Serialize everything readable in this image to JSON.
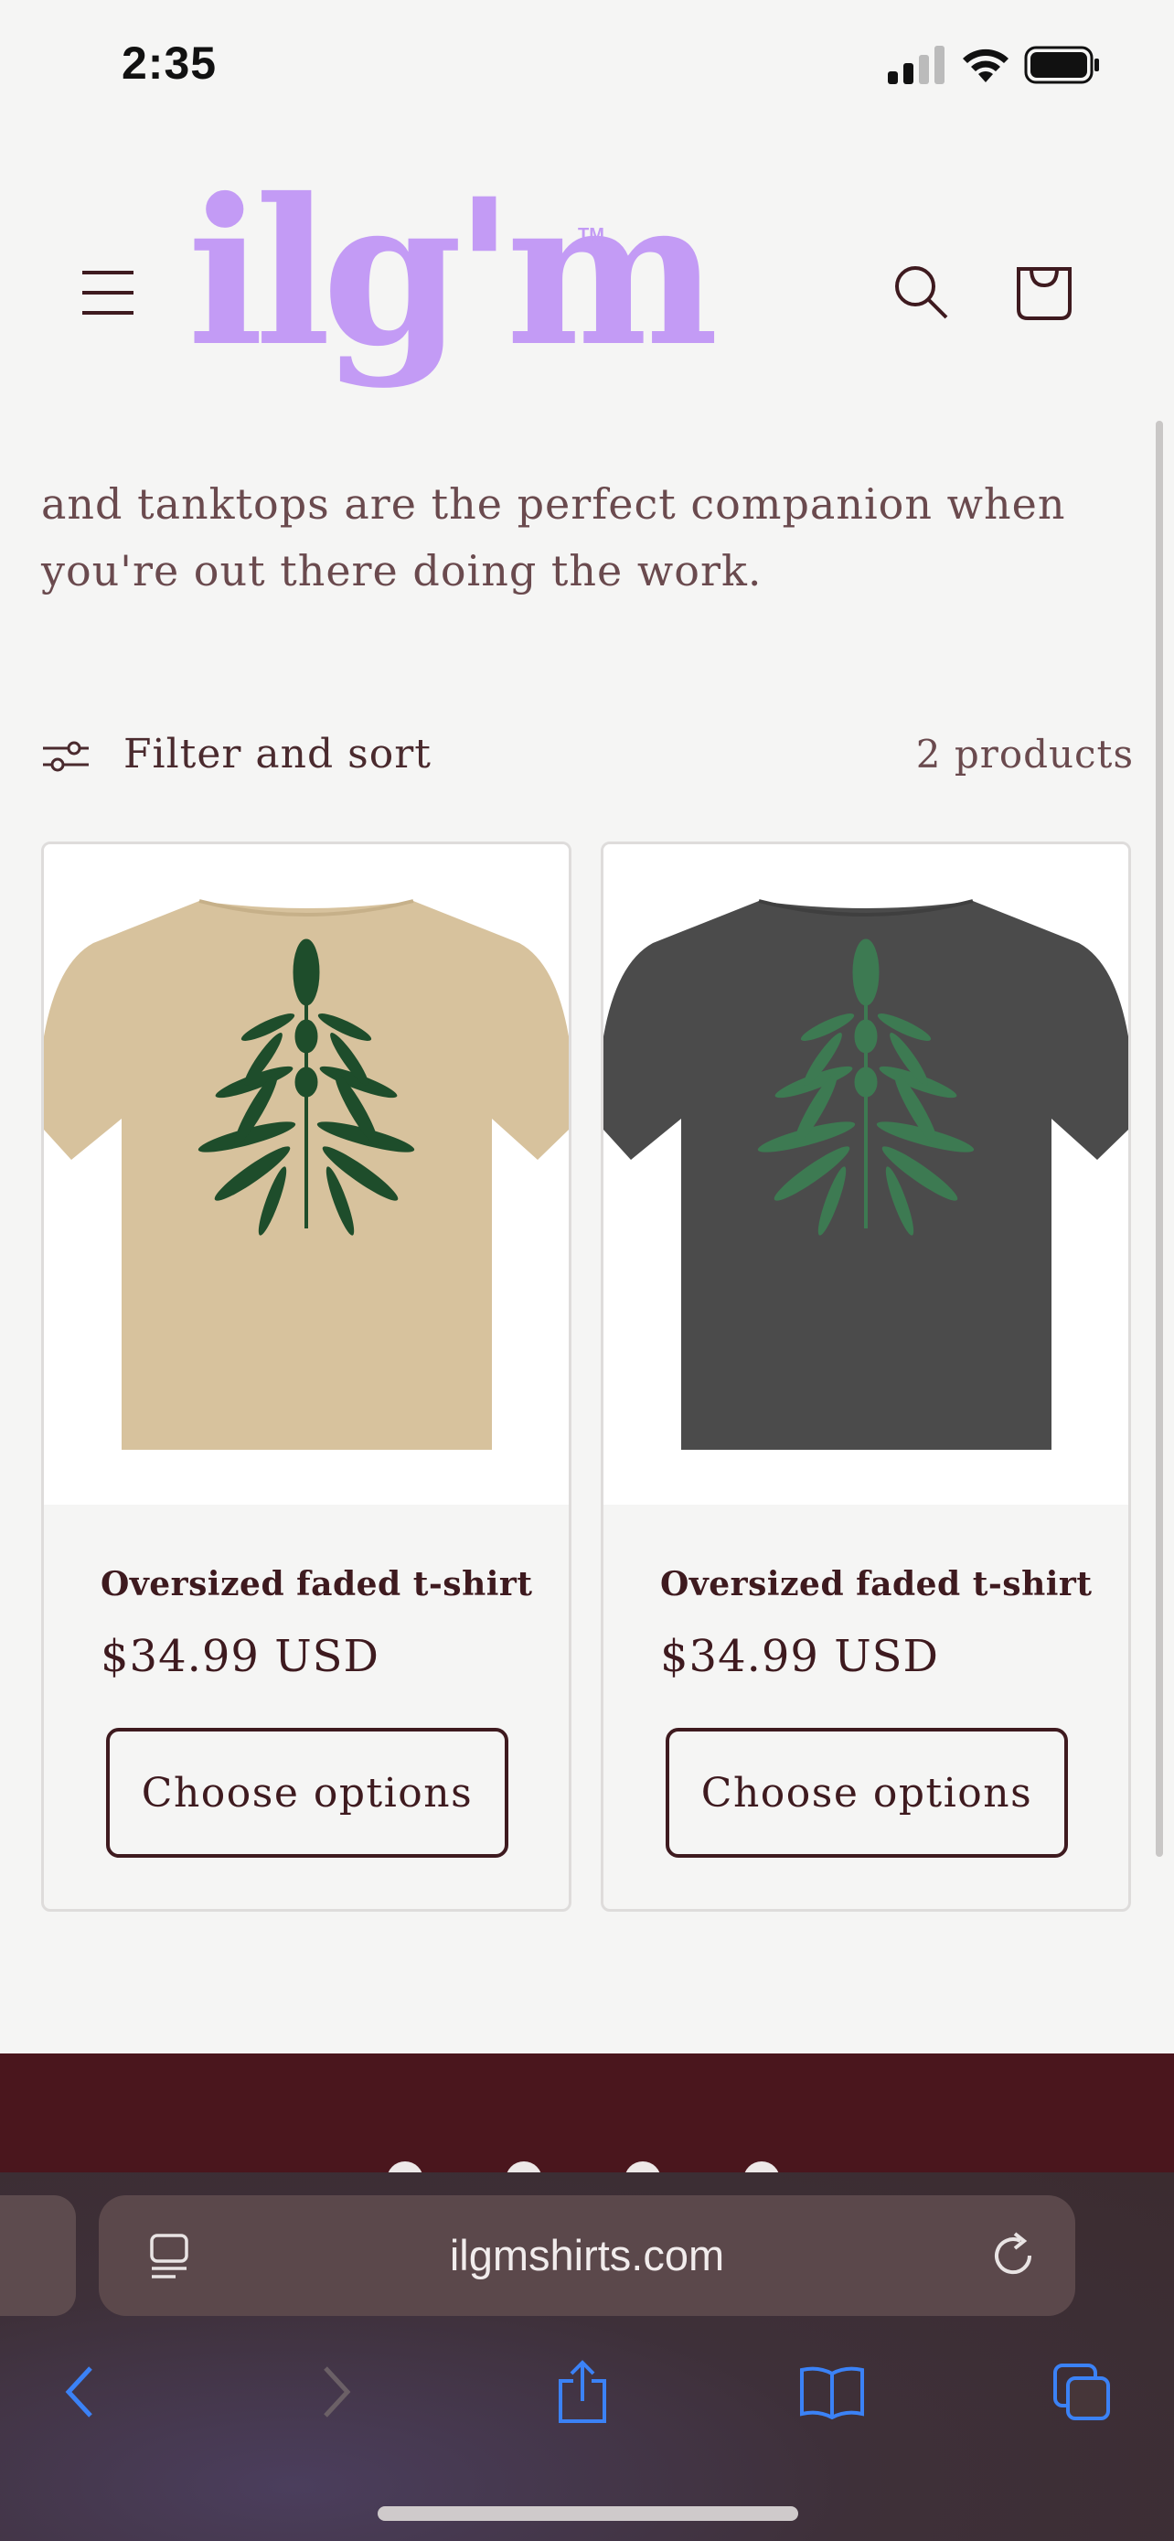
{
  "status_bar": {
    "time": "2:35"
  },
  "header": {
    "logo_text": "ilg'm",
    "logo_tm": "TM",
    "brand_color": "#c39bf5"
  },
  "collection": {
    "intro_text": "and tanktops are the perfect companion when you're out there doing the work.",
    "filter_label": "Filter and sort",
    "product_count": "2 products"
  },
  "products": [
    {
      "title": "Oversized faded t-shirt",
      "price": "$34.99 USD",
      "button": "Choose options",
      "shirt_color": "#d7c29d",
      "print_color": "#1e4d2b"
    },
    {
      "title": "Oversized faded t-shirt",
      "price": "$34.99 USD",
      "button": "Choose options",
      "shirt_color": "#4b4b4b",
      "print_color": "#3d7a52"
    }
  ],
  "browser": {
    "url": "ilgmshirts.com"
  },
  "colors": {
    "text": "#3e1a1f",
    "footer": "#4a161d",
    "accent_icon": "#3b82f6"
  }
}
